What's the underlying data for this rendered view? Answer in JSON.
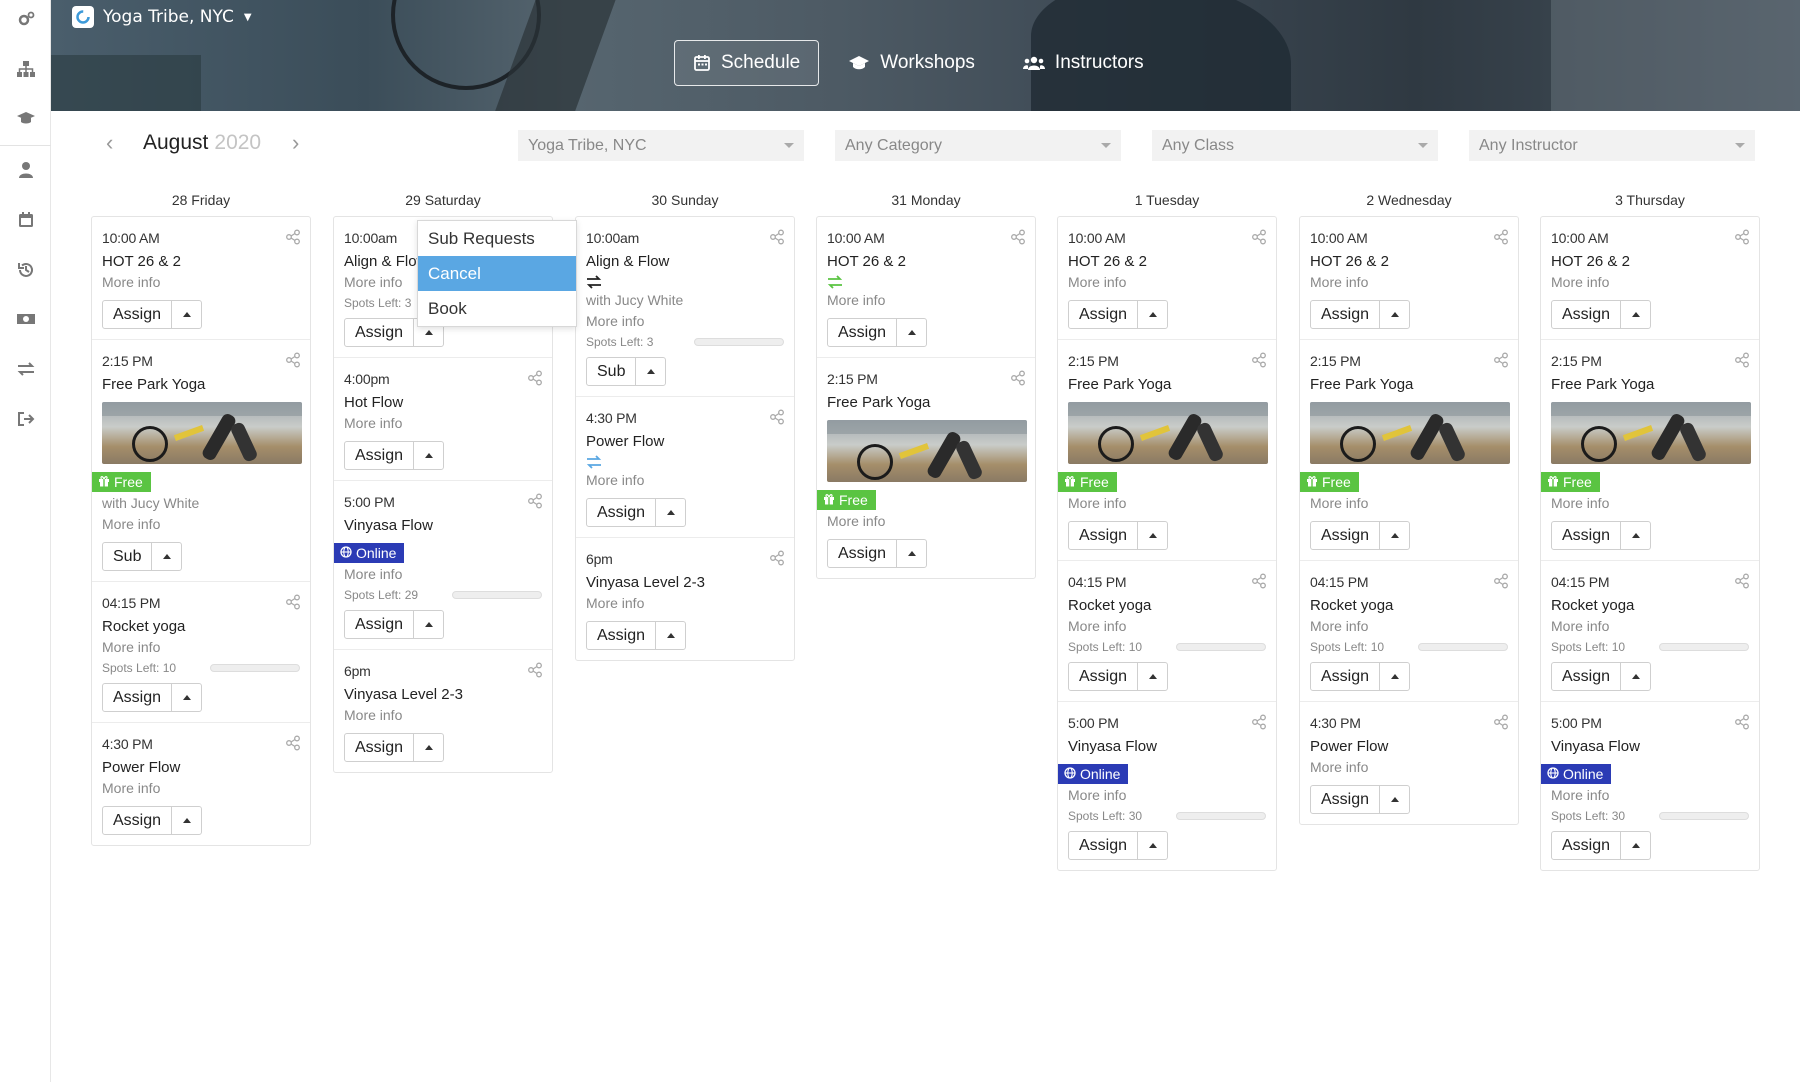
{
  "studio": {
    "name": "Yoga Tribe, NYC"
  },
  "nav": {
    "tabs": [
      {
        "label": "Schedule",
        "icon": "calendar-icon"
      },
      {
        "label": "Workshops",
        "icon": "graduation-cap-icon"
      },
      {
        "label": "Instructors",
        "icon": "users-icon"
      }
    ]
  },
  "rail": {
    "icons": [
      "gears-icon",
      "sitemap-icon",
      "graduation-cap-icon",
      "user-icon",
      "calendar-icon",
      "history-icon",
      "money-icon",
      "exchange-icon",
      "sign-out-icon"
    ]
  },
  "calendar": {
    "month": "August",
    "year": "2020",
    "filters": {
      "location": "Yoga Tribe, NYC",
      "category": "Any Category",
      "class": "Any Class",
      "instructor": "Any Instructor"
    }
  },
  "menu": {
    "items": [
      "Sub Requests",
      "Cancel",
      "Book"
    ],
    "selected": "Cancel"
  },
  "colors": {
    "free": "#5ac442",
    "online": "#2b3bb5",
    "swap_green": "#5ac442",
    "swap_blue": "#5aa7e3",
    "menu_selected": "#5aa7e3"
  },
  "days": [
    {
      "label": "28 Friday",
      "cards": [
        {
          "time": "10:00 AM",
          "title": "HOT 26 & 2",
          "more": "More info",
          "action": "Assign"
        },
        {
          "time": "2:15 PM",
          "title": "Free Park Yoga",
          "badge": "Free",
          "instructor": "with Jucy White",
          "more": "More info",
          "action": "Sub"
        },
        {
          "time": "04:15 PM",
          "title": "Rocket yoga",
          "more": "More info",
          "spots": "Spots Left: 10",
          "action": "Assign"
        },
        {
          "time": "4:30 PM",
          "title": "Power Flow",
          "more": "More info",
          "action": "Assign"
        }
      ]
    },
    {
      "label": "29 Saturday",
      "cards": [
        {
          "time": "10:00am",
          "title": "Align & Flow",
          "more": "More info",
          "spots": "Spots Left: 3",
          "action": "Assign"
        },
        {
          "time": "4:00pm",
          "title": "Hot Flow",
          "more": "More info",
          "action": "Assign"
        },
        {
          "time": "5:00 PM",
          "title": "Vinyasa Flow",
          "badge": "Online",
          "more": "More info",
          "spots": "Spots Left: 29",
          "action": "Assign"
        },
        {
          "time": "6pm",
          "title": "Vinyasa Level 2-3",
          "more": "More info",
          "action": "Assign"
        }
      ]
    },
    {
      "label": "30 Sunday",
      "cards": [
        {
          "time": "10:00am",
          "title": "Align & Flow",
          "instructor": "with Jucy White",
          "more": "More info",
          "spots": "Spots Left: 3",
          "action": "Sub"
        },
        {
          "time": "4:30 PM",
          "title": "Power Flow",
          "more": "More info",
          "action": "Assign"
        },
        {
          "time": "6pm",
          "title": "Vinyasa Level 2-3",
          "more": "More info",
          "action": "Assign"
        }
      ]
    },
    {
      "label": "31 Monday",
      "cards": [
        {
          "time": "10:00 AM",
          "title": "HOT 26 & 2",
          "more": "More info",
          "action": "Assign"
        },
        {
          "time": "2:15 PM",
          "title": "Free Park Yoga",
          "badge": "Free",
          "more": "More info",
          "action": "Assign"
        }
      ]
    },
    {
      "label": "1 Tuesday",
      "cards": [
        {
          "time": "10:00 AM",
          "title": "HOT 26 & 2",
          "more": "More info",
          "action": "Assign"
        },
        {
          "time": "2:15 PM",
          "title": "Free Park Yoga",
          "badge": "Free",
          "more": "More info",
          "action": "Assign"
        },
        {
          "time": "04:15 PM",
          "title": "Rocket yoga",
          "more": "More info",
          "spots": "Spots Left: 10",
          "action": "Assign"
        },
        {
          "time": "5:00 PM",
          "title": "Vinyasa Flow",
          "badge": "Online",
          "more": "More info",
          "spots": "Spots Left: 30",
          "action": "Assign"
        }
      ]
    },
    {
      "label": "2 Wednesday",
      "cards": [
        {
          "time": "10:00 AM",
          "title": "HOT 26 & 2",
          "more": "More info",
          "action": "Assign"
        },
        {
          "time": "2:15 PM",
          "title": "Free Park Yoga",
          "badge": "Free",
          "more": "More info",
          "action": "Assign"
        },
        {
          "time": "04:15 PM",
          "title": "Rocket yoga",
          "more": "More info",
          "spots": "Spots Left: 10",
          "action": "Assign"
        },
        {
          "time": "4:30 PM",
          "title": "Power Flow",
          "more": "More info",
          "action": "Assign"
        }
      ]
    },
    {
      "label": "3 Thursday",
      "cards": [
        {
          "time": "10:00 AM",
          "title": "HOT 26 & 2",
          "more": "More info",
          "action": "Assign"
        },
        {
          "time": "2:15 PM",
          "title": "Free Park Yoga",
          "badge": "Free",
          "more": "More info",
          "action": "Assign"
        },
        {
          "time": "04:15 PM",
          "title": "Rocket yoga",
          "more": "More info",
          "spots": "Spots Left: 10",
          "action": "Assign"
        },
        {
          "time": "5:00 PM",
          "title": "Vinyasa Flow",
          "badge": "Online",
          "more": "More info",
          "spots": "Spots Left: 30",
          "action": "Assign"
        }
      ]
    }
  ]
}
